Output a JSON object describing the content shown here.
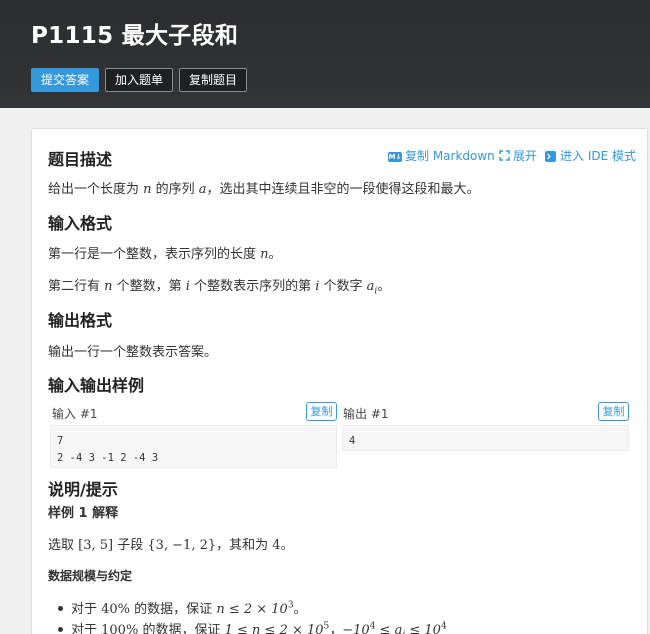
{
  "header": {
    "title": "P1115 最大子段和",
    "buttons": {
      "submit": "提交答案",
      "add": "加入题单",
      "copy": "复制题目"
    }
  },
  "toolbar": {
    "copy_markdown": "复制 Markdown",
    "expand": "展开",
    "ide_mode": "进入 IDE 模式"
  },
  "sections": {
    "description_title": "题目描述",
    "description": {
      "pre": "给出一个长度为 ",
      "var_n": "n",
      "mid": " 的序列 ",
      "var_a": "a",
      "post": "，选出其中连续且非空的一段使得这段和最大。"
    },
    "input_title": "输入格式",
    "input_line1": {
      "pre": "第一行是一个整数，表示序列的长度 ",
      "var_n": "n",
      "post": "。"
    },
    "input_line2": {
      "pre": "第二行有 ",
      "var_n": "n",
      "mid1": " 个整数，第 ",
      "var_i1": "i",
      "mid2": " 个整数表示序列的第 ",
      "var_i2": "i",
      "mid3": " 个数字 ",
      "var_a": "a",
      "sub_i": "i",
      "post": "。"
    },
    "output_title": "输出格式",
    "output_line": "输出一行一个整数表示答案。",
    "samples_title": "输入输出样例",
    "hint_title": "说明/提示",
    "sample_explain_title": "样例 1 解释",
    "sample_explain": {
      "pre": "选取 ",
      "range": "[3, 5]",
      "mid1": " 子段 ",
      "set": "{3, −1, 2}",
      "mid2": "，其和为 ",
      "sum": "4",
      "post": "。"
    },
    "constraints_title": "数据规模与约定",
    "constraints": [
      {
        "pre": "对于 ",
        "pct": "40%",
        "mid": " 的数据，保证 ",
        "expr": "n ≤ 2 × 10",
        "sup": "3",
        "post": "。"
      },
      {
        "pre": "对于 ",
        "pct": "100%",
        "mid": " 的数据，保证 ",
        "expr": "1 ≤ n ≤ 2 × 10",
        "sup": "5",
        "expr2": "，−10",
        "sup2": "4",
        "expr3": " ≤ a",
        "sub": "i",
        "expr4": " ≤ 10",
        "sup3": "4"
      }
    ]
  },
  "samples": {
    "input_label": "输入 #1",
    "output_label": "输出 #1",
    "copy_label": "复制",
    "input_value": "7\n2 -4 3 -1 2 -4 3",
    "output_value": "4"
  },
  "colors": {
    "accent": "#3498db",
    "header_bg": "#2f3033"
  }
}
